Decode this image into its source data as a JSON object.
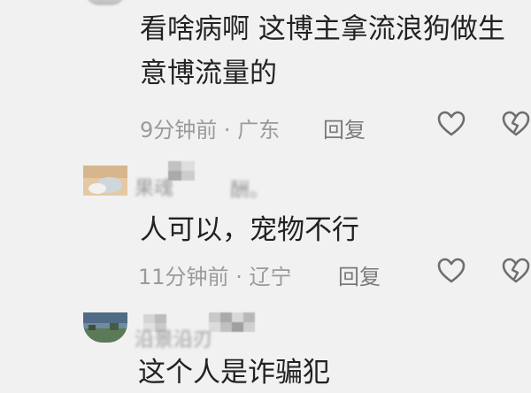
{
  "comments": [
    {
      "text_line1": "看啥病啊 这博主拿流浪狗做生",
      "text_line2": "意博流量的",
      "time": "9分钟前",
      "location": "广东",
      "reply_label": "回复"
    },
    {
      "username": "果魂",
      "username_suffix": "酬。",
      "text_line1": "人可以，宠物不行",
      "time": "11分钟前",
      "location": "辽宁",
      "reply_label": "回复"
    },
    {
      "username": "沿景沿刃",
      "text_line1": "这个人是诈骗犯"
    }
  ],
  "colors": {
    "background": "#f1f1f1",
    "text": "#222222",
    "meta": "#9a9a9a",
    "icon": "#6e6e6e"
  },
  "icons": [
    "heart-icon",
    "broken-heart-icon"
  ]
}
